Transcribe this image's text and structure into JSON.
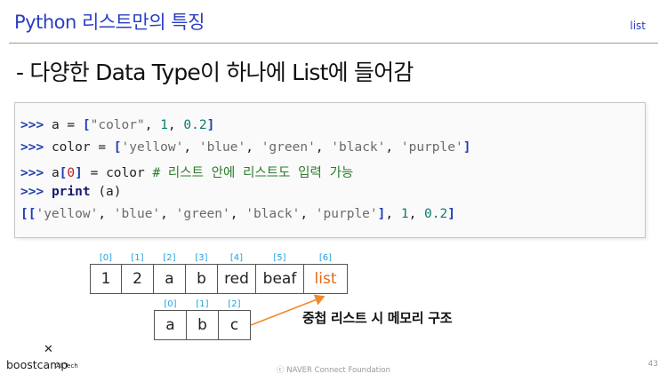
{
  "header": {
    "title": "Python 리스트만의 특징",
    "tag": "list"
  },
  "subtitle": "- 다양한 Data Type이 하나에 List에 들어감",
  "code": {
    "prompt": ">>>",
    "line1": {
      "a": "a",
      "eq": "=",
      "lb": "[",
      "s1": "\"color\"",
      "c1": ",",
      "n1": "1",
      "c2": ",",
      "n2": "0.2",
      "rb": "]"
    },
    "line2": {
      "var": "color",
      "eq": "=",
      "lb": "[",
      "s1": "'yellow'",
      "s2": "'blue'",
      "s3": "'green'",
      "s4": "'black'",
      "s5": "'purple'",
      "rb": "]",
      "comma": ","
    },
    "line3": {
      "a": "a",
      "lb": "[",
      "idx": "0",
      "rb": "]",
      "eq": "=",
      "var": "color",
      "comment": "# 리스트 안에 리스트도 입력 가능"
    },
    "line4": {
      "kw": "print",
      "arg": "(a)"
    },
    "line5": {
      "lbb": "[[",
      "s1": "'yellow'",
      "s2": "'blue'",
      "s3": "'green'",
      "s4": "'black'",
      "s5": "'purple'",
      "rb": "]",
      "n1": "1",
      "n2": "0.2",
      "rbb": "]",
      "comma": ","
    }
  },
  "outer_list": {
    "cells": [
      {
        "index": "[0]",
        "value": "1"
      },
      {
        "index": "[1]",
        "value": "2"
      },
      {
        "index": "[2]",
        "value": "a"
      },
      {
        "index": "[3]",
        "value": "b"
      },
      {
        "index": "[4]",
        "value": "red"
      },
      {
        "index": "[5]",
        "value": "beaf"
      },
      {
        "index": "[6]",
        "value": "list"
      }
    ]
  },
  "inner_list": {
    "cells": [
      {
        "index": "[0]",
        "value": "a"
      },
      {
        "index": "[1]",
        "value": "b"
      },
      {
        "index": "[2]",
        "value": "c"
      }
    ]
  },
  "caption": "중첩 리스트 시 메모리 구조",
  "colors": {
    "title": "#2b3ec4",
    "highlight": "#e36b14",
    "index": "#1ea4dc",
    "arrow": "#f08a2c"
  },
  "footer": {
    "logo": "boostcamp",
    "logo_sub": "AI Tech",
    "logo_icon": "x-mark-icon",
    "copyright": "ⓒ NAVER Connect Foundation",
    "page": "43"
  }
}
